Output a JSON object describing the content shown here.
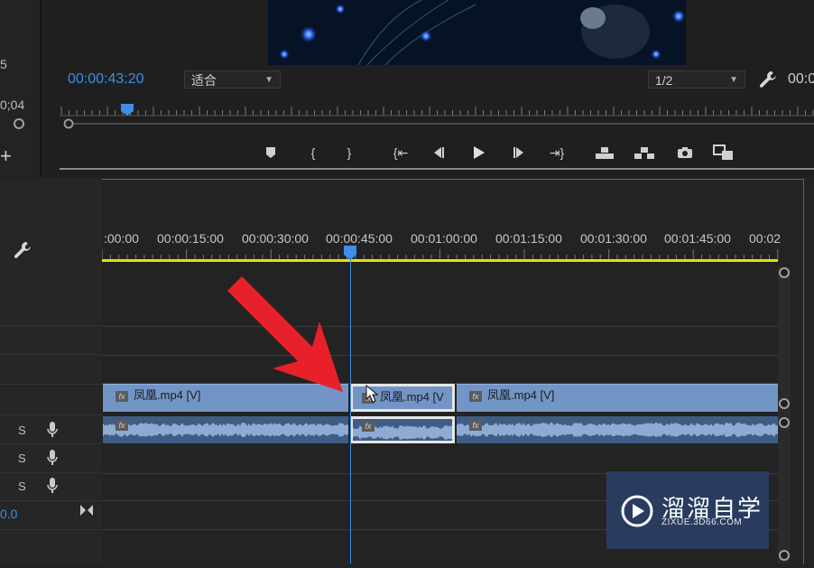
{
  "program_monitor": {
    "timecode": "00:00:43:20",
    "fit_select": "适合",
    "resolution_select": "1/2",
    "timecode_right": "00:0",
    "left_value_1": "5",
    "left_value_2": "0;04"
  },
  "timeline": {
    "ruler_labels": [
      ":00:00",
      "00:00:15:00",
      "00:00:30:00",
      "00:00:45:00",
      "00:01:00:00",
      "00:01:15:00",
      "00:01:30:00",
      "00:01:45:00",
      "00:02"
    ],
    "video_clips": [
      {
        "label": "凤凰.mp4 [V]"
      },
      {
        "label": "凤凰.mp4 [V"
      },
      {
        "label": "凤凰.mp4 [V]"
      }
    ],
    "audio_tracks": [
      {
        "solo": "S"
      },
      {
        "solo": "S"
      },
      {
        "solo": "S"
      }
    ],
    "master_value": "0.0"
  },
  "watermark": {
    "title": "溜溜自学",
    "url": "ZIXUE.3D66.COM"
  },
  "colors": {
    "accent": "#3d8ee6",
    "video_clip": "#7295c6",
    "audio_clip": "#3f5c85",
    "work_area": "#e3e300",
    "arrow": "#e8202a"
  }
}
